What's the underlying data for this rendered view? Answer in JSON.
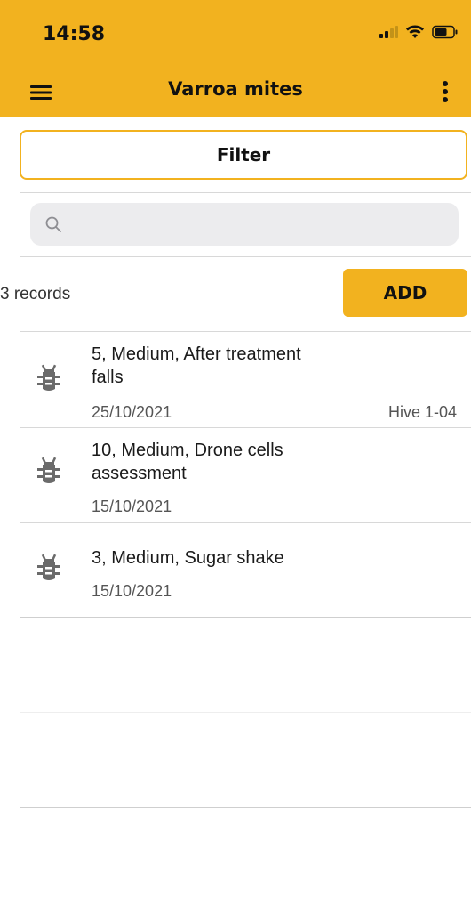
{
  "status": {
    "time": "14:58"
  },
  "nav": {
    "title": "Varroa mites"
  },
  "filter": {
    "label": "Filter"
  },
  "search": {
    "placeholder": ""
  },
  "list_header": {
    "count_text": "3 records",
    "add_label": "ADD"
  },
  "records": [
    {
      "title": "5, Medium, After treatment falls",
      "date": "25/10/2021",
      "hive": "Hive 1-04"
    },
    {
      "title": "10, Medium, Drone cells assessment",
      "date": "15/10/2021",
      "hive": ""
    },
    {
      "title": "3, Medium, Sugar shake",
      "date": "15/10/2021",
      "hive": ""
    }
  ],
  "colors": {
    "accent": "#f2b21f",
    "icon": "#6b6b6b"
  },
  "icons": {
    "record": "bug-icon",
    "menu": "hamburger-menu-icon",
    "more": "more-vertical-icon",
    "search": "search-icon"
  }
}
